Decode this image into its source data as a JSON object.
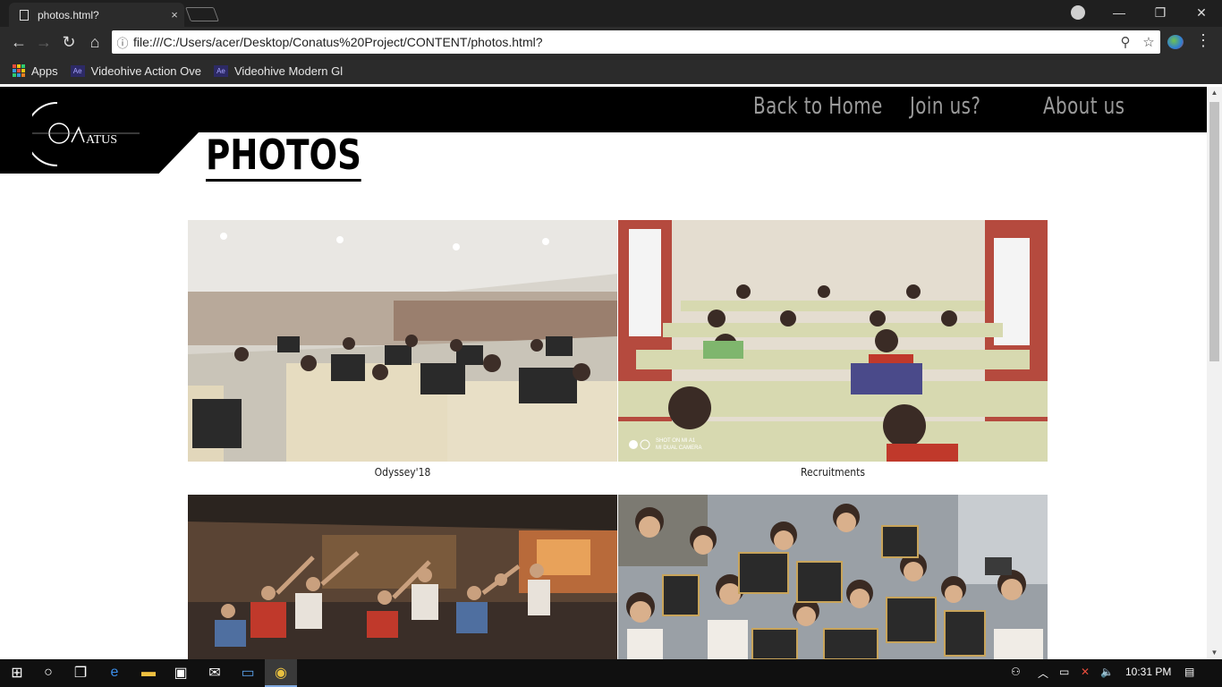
{
  "browser": {
    "tab_title": "photos.html?",
    "tab_close": "×",
    "url": "file:///C:/Users/acer/Desktop/Conatus%20Project/CONTENT/photos.html?",
    "bookmarks": [
      {
        "label": "Apps",
        "icon": "apps-grid-icon"
      },
      {
        "label": "Videohive Action Ove",
        "icon": "after-effects-icon"
      },
      {
        "label": "Videohive Modern Gl",
        "icon": "after-effects-icon"
      }
    ],
    "window_controls": {
      "minimize": "—",
      "restore": "❐",
      "close": "✕"
    }
  },
  "site": {
    "logo_text": "ATUS",
    "nav": [
      {
        "label": "Back to Home"
      },
      {
        "label": "Join us?"
      },
      {
        "label": "About us"
      }
    ],
    "page_title": "PHOTOS",
    "gallery": [
      {
        "caption": "Odyssey'18",
        "scene": "computer-lab"
      },
      {
        "caption": "Recruitments",
        "scene": "exam-hall",
        "watermark": "SHOT ON MI A1\nMI DUAL CAMERA"
      },
      {
        "caption": "",
        "scene": "restaurant-group"
      },
      {
        "caption": "",
        "scene": "group-with-frames"
      }
    ]
  },
  "taskbar": {
    "time": "10:31 PM",
    "colors": {
      "background": "#101010",
      "accent": "#7fa8e0"
    }
  }
}
